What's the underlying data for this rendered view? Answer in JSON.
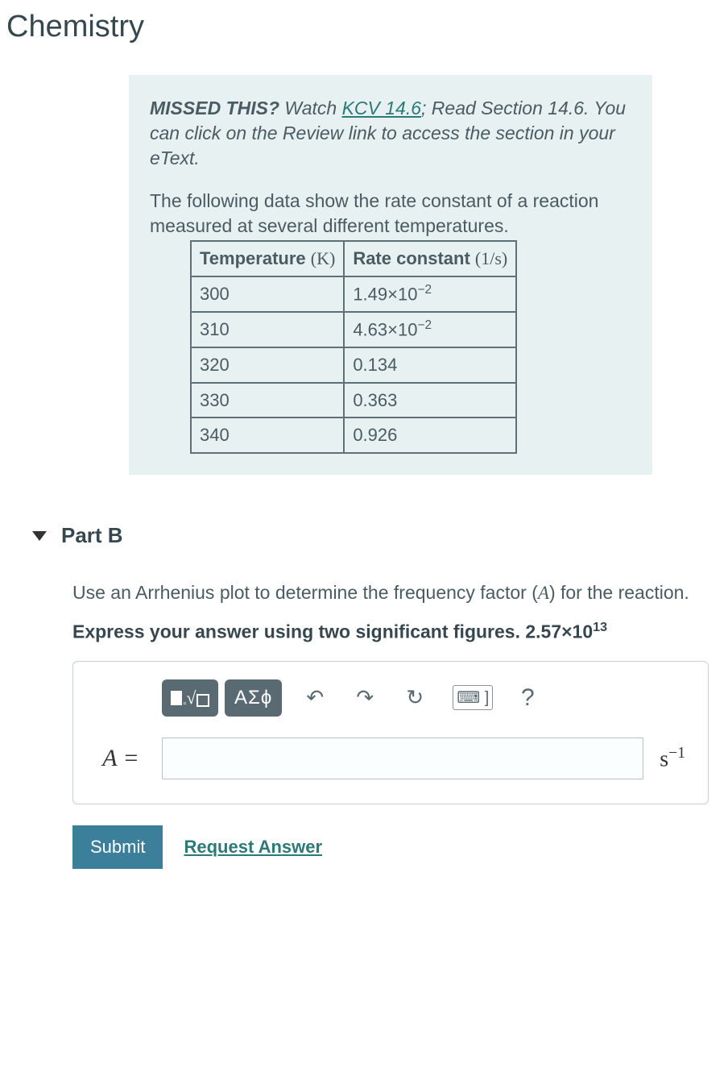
{
  "page_title": "Chemistry",
  "hint": {
    "missed_label": "MISSED THIS?",
    "watch_text": " Watch ",
    "link_text": "KCV 14.6",
    "after_link": "; Read Section 14.6. You can click on the Review link to access the section in your eText."
  },
  "question_text": "The following data show the rate constant of a reaction measured at several different temperatures.",
  "table": {
    "headers": {
      "col1_label": "Temperature",
      "col1_unit": "(K)",
      "col2_label": "Rate constant",
      "col2_unit": "(1/s)"
    },
    "rows": [
      {
        "temp": "300",
        "rate_base": "1.49×10",
        "rate_exp": "−2",
        "rate_plain": ""
      },
      {
        "temp": "310",
        "rate_base": "4.63×10",
        "rate_exp": "−2",
        "rate_plain": ""
      },
      {
        "temp": "320",
        "rate_base": "",
        "rate_exp": "",
        "rate_plain": "0.134"
      },
      {
        "temp": "330",
        "rate_base": "",
        "rate_exp": "",
        "rate_plain": "0.363"
      },
      {
        "temp": "340",
        "rate_base": "",
        "rate_exp": "",
        "rate_plain": "0.926"
      }
    ]
  },
  "part": {
    "label": "Part B",
    "instruction_pre": "Use an Arrhenius plot to determine the frequency factor (",
    "instruction_var": "A",
    "instruction_post": ") for the reaction.",
    "express_pre": "Express your answer using two significant figures. 2.57×10",
    "express_exp": "13"
  },
  "toolbar": {
    "symbols_label": "ΑΣϕ",
    "undo": "↶",
    "redo": "↷",
    "reset": "↻",
    "keyboard": "⌨ ]",
    "help": "?"
  },
  "answer": {
    "var_label": "A =",
    "value": "",
    "unit_base": "s",
    "unit_exp": "−1"
  },
  "actions": {
    "submit": "Submit",
    "request": "Request Answer"
  }
}
